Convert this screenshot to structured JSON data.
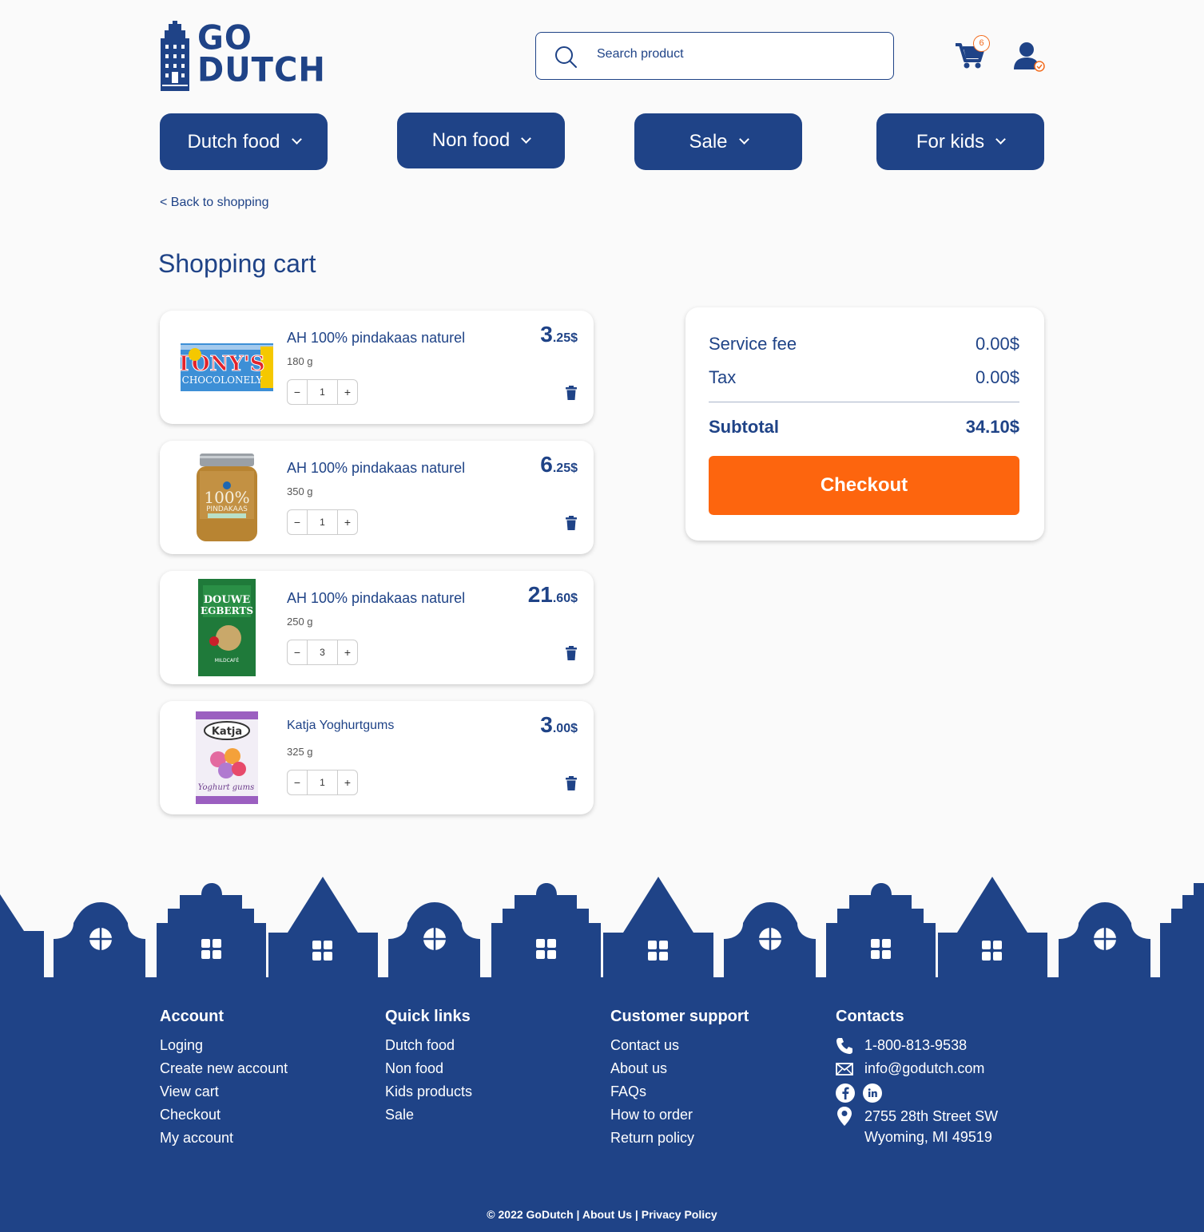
{
  "header": {
    "logo_text_1": "GO",
    "logo_text_2": "DUTCH",
    "search_placeholder": "Search product",
    "cart_count": "6"
  },
  "nav": [
    {
      "label": "Dutch food"
    },
    {
      "label": "Non food"
    },
    {
      "label": "Sale"
    },
    {
      "label": "For kids"
    }
  ],
  "back_link": "< Back to shopping",
  "page_title": "Shopping cart",
  "cart_items": [
    {
      "name": "AH 100% pindakaas naturel",
      "weight": "180 g",
      "price_int": "3",
      "price_dec": ".25$",
      "qty": "1",
      "image": "tonys-chocolonely-bar"
    },
    {
      "name": "AH 100% pindakaas naturel",
      "weight": "350 g",
      "price_int": "6",
      "price_dec": ".25$",
      "qty": "1",
      "image": "peanut-butter-jar"
    },
    {
      "name": "AH 100% pindakaas naturel",
      "weight": "250 g",
      "price_int": "21",
      "price_dec": ".60$",
      "qty": "3",
      "image": "douwe-egberts-coffee"
    },
    {
      "name": "Katja Yoghurtgums",
      "weight": "325 g",
      "price_int": "3",
      "price_dec": ".00$",
      "qty": "1",
      "image": "katja-candy-bag"
    }
  ],
  "summary": {
    "service_fee_label": "Service fee",
    "service_fee_value": "0.00$",
    "tax_label": "Tax",
    "tax_value": "0.00$",
    "subtotal_label": "Subtotal",
    "subtotal_value": "34.10$",
    "checkout_label": "Checkout"
  },
  "footer": {
    "account": {
      "title": "Account",
      "links": [
        "Loging",
        "Create new account",
        "View cart",
        "Checkout",
        "My account"
      ]
    },
    "quick_links": {
      "title": "Quick links",
      "links": [
        "Dutch food",
        "Non food",
        "Kids products",
        "Sale"
      ]
    },
    "support": {
      "title": "Customer support",
      "links": [
        "Contact us",
        "About us",
        "FAQs",
        "How to order",
        "Return policy"
      ]
    },
    "contacts": {
      "title": "Contacts",
      "phone": "1-800-813-9538",
      "email": "info@godutch.com",
      "address_1": "2755 28th Street SW",
      "address_2": "Wyoming, MI 49519"
    },
    "copyright": "© 2022 GoDutch",
    "about": "About Us",
    "privacy": "Privacy Policy"
  },
  "colors": {
    "primary": "#1f4387",
    "accent": "#fd650e",
    "background": "#fafafa"
  }
}
